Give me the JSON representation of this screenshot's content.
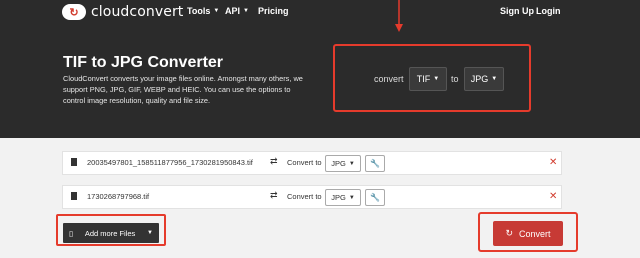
{
  "nav": {
    "brand": "cloudconvert",
    "tools": "Tools",
    "api": "API",
    "pricing": "Pricing",
    "signup": "Sign Up",
    "login": "Login"
  },
  "hero": {
    "title": "TIF to JPG Converter",
    "description": "CloudConvert converts your image files online. Amongst many others, we support PNG, JPG, GIF, WEBP and HEIC. You can use the options to control image resolution, quality and file size.",
    "convert_label": "convert",
    "from_format": "TIF",
    "to_label": "to",
    "to_format": "JPG"
  },
  "files": [
    {
      "name": "20035497801_158511877956_1730281950843.tif",
      "convert_to_label": "Convert to",
      "format": "JPG"
    },
    {
      "name": "1730268797968.tif",
      "convert_to_label": "Convert to",
      "format": "JPG"
    }
  ],
  "actions": {
    "add_more": "Add more Files",
    "convert": "Convert"
  },
  "colors": {
    "accent": "#c73a35",
    "annotation": "#e53b2c",
    "hero_bg": "#2b2b2b"
  }
}
